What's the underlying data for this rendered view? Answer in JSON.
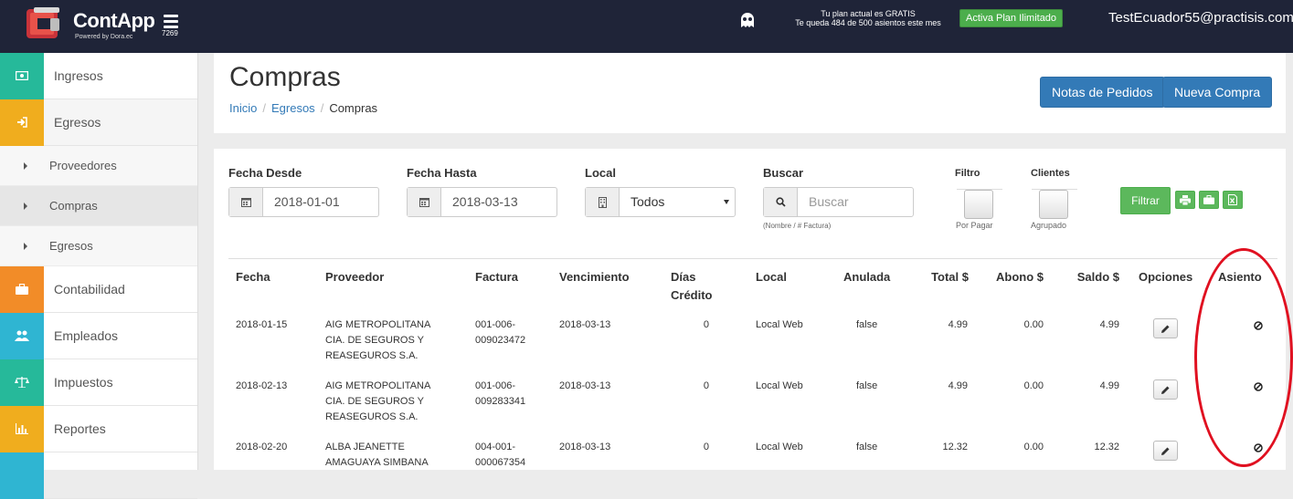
{
  "topbar": {
    "logo_text": "ContApp",
    "logo_sub": "Powered by Dora.ec",
    "menu_number": "7269",
    "plan_line1": "Tu plan actual es GRATIS",
    "plan_line2": "Te queda 484 de 500 asientos este mes",
    "activa_label": "Activa Plan Ilimitado",
    "user_email": "TestEcuador55@practisis.com"
  },
  "sidebar": {
    "items": [
      {
        "label": "Ingresos",
        "color": "#26b99a",
        "icon": "money-icon"
      },
      {
        "label": "Egresos",
        "color": "#f0ad1e",
        "icon": "sign-in-icon"
      },
      {
        "label": "Contabilidad",
        "color": "#f28c28",
        "icon": "briefcase-icon"
      },
      {
        "label": "Empleados",
        "color": "#2fb5d2",
        "icon": "users-icon"
      },
      {
        "label": "Impuestos",
        "color": "#26b99a",
        "icon": "balance-scale-icon"
      },
      {
        "label": "Reportes",
        "color": "#f0ad1e",
        "icon": "bar-chart-icon"
      }
    ],
    "subitems": [
      {
        "label": "Proveedores"
      },
      {
        "label": "Compras"
      },
      {
        "label": "Egresos"
      }
    ]
  },
  "header": {
    "title": "Compras",
    "breadcrumb": {
      "home": "Inicio",
      "parent": "Egresos",
      "current": "Compras"
    },
    "btn_notas": "Notas de Pedidos",
    "btn_nueva": "Nueva Compra"
  },
  "filters": {
    "fecha_desde_label": "Fecha Desde",
    "fecha_desde_value": "2018-01-01",
    "fecha_hasta_label": "Fecha Hasta",
    "fecha_hasta_value": "2018-03-13",
    "local_label": "Local",
    "local_value": "Todos",
    "buscar_label": "Buscar",
    "buscar_placeholder": "Buscar",
    "buscar_hint": "(Nombre / # Factura)",
    "filtro_label": "Filtro",
    "filtro_sub": "Por Pagar",
    "clientes_label": "Clientes",
    "clientes_sub": "Agrupado",
    "filtrar_label": "Filtrar"
  },
  "table": {
    "headers": {
      "fecha": "Fecha",
      "proveedor": "Proveedor",
      "factura": "Factura",
      "vencimiento": "Vencimiento",
      "dias_credito": "Días Crédito",
      "local": "Local",
      "anulada": "Anulada",
      "total": "Total $",
      "abono": "Abono $",
      "saldo": "Saldo $",
      "opciones": "Opciones",
      "asiento": "Asiento"
    },
    "rows": [
      {
        "fecha": "2018-01-15",
        "proveedor": "AIG METROPOLITANA CIA. DE SEGUROS Y REASEGUROS S.A.",
        "factura": "001-006-009023472",
        "vencimiento": "2018-03-13",
        "dias": "0",
        "local": "Local Web",
        "anulada": "false",
        "total": "4.99",
        "abono": "0.00",
        "saldo": "4.99"
      },
      {
        "fecha": "2018-02-13",
        "proveedor": "AIG METROPOLITANA CIA. DE SEGUROS Y REASEGUROS S.A.",
        "factura": "001-006-009283341",
        "vencimiento": "2018-03-13",
        "dias": "0",
        "local": "Local Web",
        "anulada": "false",
        "total": "4.99",
        "abono": "0.00",
        "saldo": "4.99"
      },
      {
        "fecha": "2018-02-20",
        "proveedor": "ALBA JEANETTE AMAGUAYA SIMBANA",
        "factura": "004-001-000067354",
        "vencimiento": "2018-03-13",
        "dias": "0",
        "local": "Local Web",
        "anulada": "false",
        "total": "12.32",
        "abono": "0.00",
        "saldo": "12.32"
      }
    ]
  },
  "colors": {
    "topbar": "#1f2438",
    "primary": "#337ab7",
    "success": "#5cb85c",
    "annotation": "#e01020"
  }
}
